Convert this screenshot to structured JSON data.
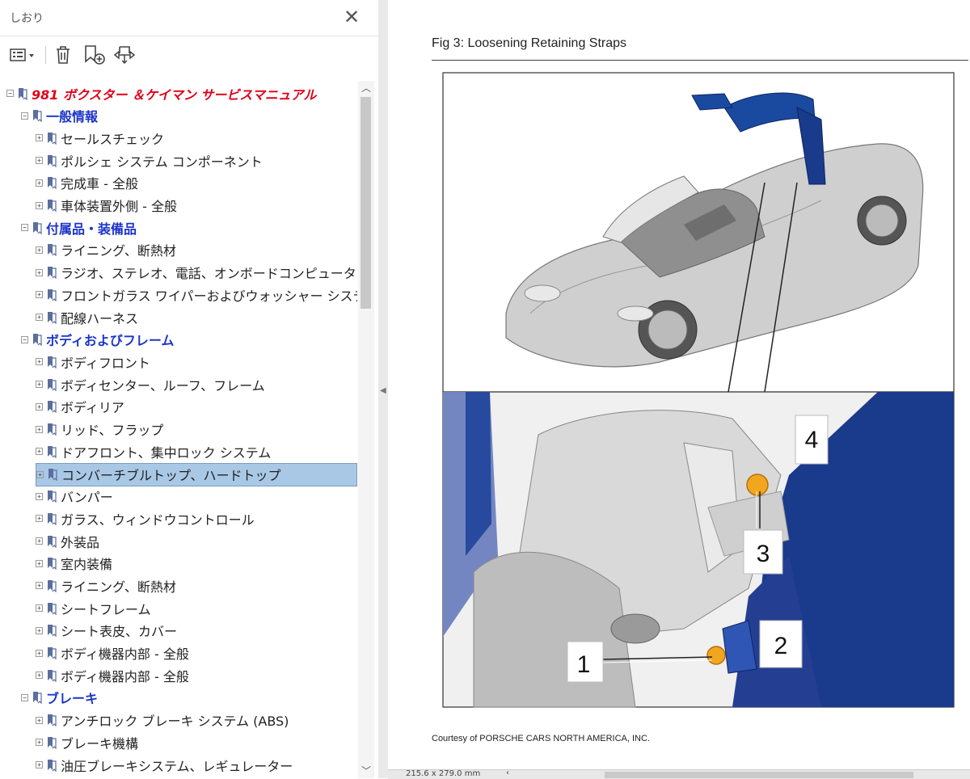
{
  "panel": {
    "title": "しおり",
    "close_icon": "close-icon"
  },
  "toolbar": {
    "options_icon": "list-options-icon",
    "delete_icon": "trash-icon",
    "new_bookmark_icon": "new-bookmark-icon",
    "expand_icon": "expand-bookmark-icon"
  },
  "tree": [
    {
      "label": "981 ボクスター ＆ケイマン  サービスマニュアル",
      "level": 0,
      "expanded": true
    },
    {
      "label": "一般情報",
      "level": 1,
      "expanded": true
    },
    {
      "label": "セールスチェック",
      "level": 2
    },
    {
      "label": "ポルシェ システム コンポーネント",
      "level": 2
    },
    {
      "label": "完成車 - 全般",
      "level": 2
    },
    {
      "label": "車体装置外側 - 全般",
      "level": 2
    },
    {
      "label": "付属品・装備品",
      "level": 1,
      "expanded": true
    },
    {
      "label": "ライニング、断熱材",
      "level": 2
    },
    {
      "label": "ラジオ、ステレオ、電話、オンボードコンピュータ",
      "level": 2
    },
    {
      "label": "フロントガラス ワイパーおよびウォッシャー システム",
      "level": 2
    },
    {
      "label": "配線ハーネス",
      "level": 2
    },
    {
      "label": "ボディおよびフレーム",
      "level": 1,
      "expanded": true
    },
    {
      "label": "ボディフロント",
      "level": 2
    },
    {
      "label": "ボディセンター、ルーフ、フレーム",
      "level": 2
    },
    {
      "label": "ボディリア",
      "level": 2
    },
    {
      "label": "リッド、フラップ",
      "level": 2
    },
    {
      "label": "ドアフロント、集中ロック システム",
      "level": 2
    },
    {
      "label": "コンバーチブルトップ、ハードトップ",
      "level": 2,
      "selected": true
    },
    {
      "label": "バンパー",
      "level": 2
    },
    {
      "label": "ガラス、ウィンドウコントロール",
      "level": 2
    },
    {
      "label": "外装品",
      "level": 2
    },
    {
      "label": "室内装備",
      "level": 2
    },
    {
      "label": "ライニング、断熱材",
      "level": 2
    },
    {
      "label": "シートフレーム",
      "level": 2
    },
    {
      "label": "シート表皮、カバー",
      "level": 2
    },
    {
      "label": "ボディ機器内部 - 全般",
      "level": 2
    },
    {
      "label": "ボディ機器内部 - 全般",
      "level": 2
    },
    {
      "label": "ブレーキ",
      "level": 1,
      "expanded": true
    },
    {
      "label": "アンチロック ブレーキ システム (ABS)",
      "level": 2
    },
    {
      "label": "ブレーキ機構",
      "level": 2
    },
    {
      "label": "油圧ブレーキシステム、レギュレーター",
      "level": 2
    }
  ],
  "document": {
    "figure_title": "Fig 3: Loosening Retaining Straps",
    "callouts": [
      "1",
      "2",
      "3",
      "4"
    ],
    "courtesy": "Courtesy of PORSCHE CARS NORTH AMERICA, INC."
  },
  "statusbar": {
    "page_size": "215.6 x 279.0 mm"
  },
  "colors": {
    "level0": "#e0001a",
    "level1": "#1c35c8",
    "selection": "#a9c8e6",
    "roof_blue": "#1a3a8c"
  }
}
